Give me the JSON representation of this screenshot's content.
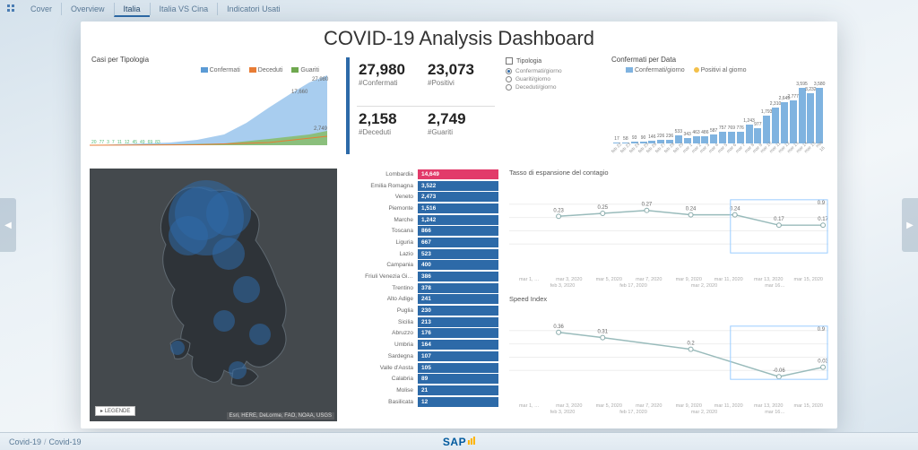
{
  "nav": {
    "tabs": [
      "Cover",
      "Overview",
      "Italia",
      "Italia VS Cina",
      "Indicatori Usati"
    ],
    "active": 2
  },
  "title": "COVID-19  Analysis Dashboard",
  "casi": {
    "title": "Casi per Tipologia",
    "legend": [
      "Confermati",
      "Deceduti",
      "Guariti"
    ],
    "legend_colors": [
      "#5b9bd5",
      "#e87c35",
      "#6fa84f"
    ],
    "labels_end": [
      "27,980",
      "17,660",
      "2,749"
    ],
    "start_pts": [
      "20",
      "77",
      "3",
      "7",
      "11",
      "12",
      "45",
      "49",
      "69",
      "83"
    ]
  },
  "kpi": [
    {
      "v": "27,980",
      "l": "#Confermati"
    },
    {
      "v": "23,073",
      "l": "#Positivi"
    },
    {
      "v": "2,158",
      "l": "#Deceduti"
    },
    {
      "v": "2,749",
      "l": "#Guariti"
    }
  ],
  "radios": {
    "hdr": "Tipologia",
    "items": [
      "Confermati/giorno",
      "Guariti/giorno",
      "Deceduti/giorno"
    ],
    "selected": 0
  },
  "confdata": {
    "title": "Confermati per Data",
    "legend": [
      "Confermati/giorno",
      "Positivi al giorno"
    ],
    "legend_colors": [
      "#7fb3e0",
      "#f3c04a"
    ]
  },
  "regions": [
    {
      "n": "Lombardia",
      "v": "14,649",
      "hot": true
    },
    {
      "n": "Emilia Romagna",
      "v": "3,522"
    },
    {
      "n": "Veneto",
      "v": "2,473"
    },
    {
      "n": "Piemonte",
      "v": "1,516"
    },
    {
      "n": "Marche",
      "v": "1,242"
    },
    {
      "n": "Toscana",
      "v": "866"
    },
    {
      "n": "Liguria",
      "v": "667"
    },
    {
      "n": "Lazio",
      "v": "523"
    },
    {
      "n": "Campania",
      "v": "400"
    },
    {
      "n": "Friuli Venezia Gi…",
      "v": "386"
    },
    {
      "n": "Trentino",
      "v": "378"
    },
    {
      "n": "Alto Adige",
      "v": "241"
    },
    {
      "n": "Puglia",
      "v": "230"
    },
    {
      "n": "Sicilia",
      "v": "213"
    },
    {
      "n": "Abruzzo",
      "v": "176"
    },
    {
      "n": "Umbria",
      "v": "164"
    },
    {
      "n": "Sardegna",
      "v": "107"
    },
    {
      "n": "Valle d'Aosta",
      "v": "105"
    },
    {
      "n": "Calabria",
      "v": "89"
    },
    {
      "n": "Molise",
      "v": "21"
    },
    {
      "n": "Basilicata",
      "v": "12"
    }
  ],
  "map": {
    "legende": "LEGENDE",
    "credits": "Esri, HERE, DeLorme, FAO, NOAA, USGS"
  },
  "tasso": {
    "title": "Tasso di espansione del contagio",
    "xA": [
      "mar 1, …",
      "mar 3, 2020",
      "mar 5, 2020",
      "mar 7, 2020",
      "mar 9, 2020",
      "mar 11, 2020",
      "mar 13, 2020",
      "mar 15, 2020"
    ],
    "xB": [
      "feb 3, 2020",
      "feb 17, 2020",
      "mar 2, 2020",
      "mar 16…"
    ],
    "pts": [
      "",
      "0.23",
      "0.25",
      "0.27",
      "0.24",
      "0.24",
      "0.17",
      "0.17"
    ]
  },
  "speed": {
    "title": "Speed Index",
    "xA": [
      "mar 1, …",
      "mar 3, 2020",
      "mar 5, 2020",
      "mar 7, 2020",
      "mar 9, 2020",
      "mar 11, 2020",
      "mar 13, 2020",
      "mar 15, 2020"
    ],
    "xB": [
      "feb 3, 2020",
      "feb 17, 2020",
      "mar 2, 2020",
      "mar 16…"
    ],
    "pts": [
      "",
      "0.36",
      "0.31",
      "",
      "0.2",
      "",
      "-0.06",
      "0.03"
    ]
  },
  "breadcrumb": [
    "Covid-19",
    "Covid-19"
  ],
  "logo": "SAP",
  "chart_data": {
    "kpis": {
      "Confermati": 27980,
      "Positivi": 23073,
      "Deceduti": 2158,
      "Guariti": 2749
    },
    "confermati_per_data": {
      "type": "bar",
      "ylabel": "Confermati/giorno",
      "categories": [
        "feb 22",
        "feb 23",
        "feb 24",
        "feb 25",
        "feb 26",
        "feb 27",
        "feb 28",
        "feb 29",
        "mar 1",
        "mar 2",
        "mar 3",
        "mar 4",
        "mar 5",
        "mar 6",
        "mar 7",
        "mar 8",
        "mar 9",
        "mar 10",
        "mar 11",
        "mar 12",
        "mar 13",
        "mar 14",
        "mar 15",
        "mar 16"
      ],
      "values": [
        17,
        58,
        93,
        90,
        146,
        226,
        236,
        533,
        343,
        463,
        486,
        587,
        757,
        769,
        776,
        1243,
        977,
        1793,
        2310,
        2649,
        2777,
        3595,
        3232,
        3580
      ]
    },
    "casi_cumulati": {
      "type": "area",
      "series": [
        {
          "name": "Confermati",
          "end": 27980
        },
        {
          "name": "Deceduti",
          "end": 2158
        },
        {
          "name": "Guariti",
          "end": 2749
        }
      ],
      "start_sequence": [
        20,
        77,
        3,
        7,
        11,
        12,
        45,
        49,
        69,
        83
      ]
    },
    "regions_bar": {
      "type": "bar",
      "orientation": "h",
      "categories": [
        "Lombardia",
        "Emilia Romagna",
        "Veneto",
        "Piemonte",
        "Marche",
        "Toscana",
        "Liguria",
        "Lazio",
        "Campania",
        "Friuli Venezia Giulia",
        "Trentino",
        "Alto Adige",
        "Puglia",
        "Sicilia",
        "Abruzzo",
        "Umbria",
        "Sardegna",
        "Valle d'Aosta",
        "Calabria",
        "Molise",
        "Basilicata"
      ],
      "values": [
        14649,
        3522,
        2473,
        1516,
        1242,
        866,
        667,
        523,
        400,
        386,
        378,
        241,
        230,
        213,
        176,
        164,
        107,
        105,
        89,
        21,
        12
      ]
    },
    "tasso_espansione": {
      "type": "line",
      "x": [
        "mar 1",
        "mar 3",
        "mar 5",
        "mar 7",
        "mar 9",
        "mar 11",
        "mar 13",
        "mar 15"
      ],
      "y": [
        null,
        0.23,
        0.25,
        0.27,
        0.24,
        0.24,
        0.17,
        0.17
      ],
      "ylim": [
        0,
        0.9
      ]
    },
    "speed_index": {
      "type": "line",
      "x": [
        "mar 1",
        "mar 3",
        "mar 5",
        "mar 7",
        "mar 9",
        "mar 11",
        "mar 13",
        "mar 15"
      ],
      "y": [
        null,
        0.36,
        0.31,
        null,
        0.2,
        null,
        -0.06,
        0.03
      ]
    }
  }
}
